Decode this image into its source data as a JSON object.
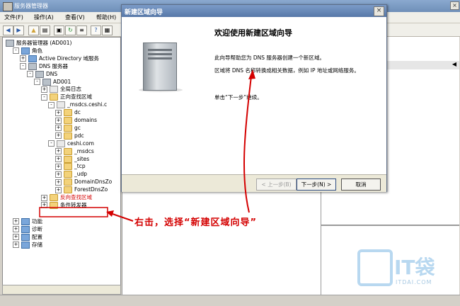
{
  "window": {
    "title": "服务器管理器"
  },
  "menu": [
    "文件(F)",
    "操作(A)",
    "查看(V)",
    "帮助(H)"
  ],
  "tree": [
    {
      "label": "服务器管理器 (AD001)",
      "icon": "server-manager-icon",
      "level": 0,
      "toggle": ""
    },
    {
      "label": "角色",
      "icon": "roles-icon",
      "level": 1,
      "toggle": "-"
    },
    {
      "label": "Active Directory 域服务",
      "icon": "ad-icon",
      "level": 2,
      "toggle": "+"
    },
    {
      "label": "DNS 服务器",
      "icon": "dns-icon",
      "level": 2,
      "toggle": "-"
    },
    {
      "label": "DNS",
      "icon": "dns-icon",
      "level": 3,
      "toggle": "-"
    },
    {
      "label": "AD001",
      "icon": "server-icon",
      "level": 4,
      "toggle": "-"
    },
    {
      "label": "全局日志",
      "icon": "log-icon",
      "level": 5,
      "toggle": "+"
    },
    {
      "label": "正向查找区域",
      "icon": "folder-icon",
      "level": 5,
      "toggle": "-"
    },
    {
      "label": "_msdcs.ceshi.c",
      "icon": "zone-icon",
      "level": 6,
      "toggle": "-"
    },
    {
      "label": "dc",
      "icon": "folder-icon",
      "level": 7,
      "toggle": "+"
    },
    {
      "label": "domains",
      "icon": "folder-icon",
      "level": 7,
      "toggle": "+"
    },
    {
      "label": "gc",
      "icon": "folder-icon",
      "level": 7,
      "toggle": "+"
    },
    {
      "label": "pdc",
      "icon": "folder-icon",
      "level": 7,
      "toggle": "+"
    },
    {
      "label": "ceshi.com",
      "icon": "zone-icon",
      "level": 6,
      "toggle": "-"
    },
    {
      "label": "_msdcs",
      "icon": "folder-icon",
      "level": 7,
      "toggle": "+"
    },
    {
      "label": "_sites",
      "icon": "folder-icon",
      "level": 7,
      "toggle": "+"
    },
    {
      "label": "_tcp",
      "icon": "folder-icon",
      "level": 7,
      "toggle": "+"
    },
    {
      "label": "_udp",
      "icon": "folder-icon",
      "level": 7,
      "toggle": "+"
    },
    {
      "label": "DomainDnsZo",
      "icon": "folder-icon",
      "level": 7,
      "toggle": "+"
    },
    {
      "label": "ForestDnsZo",
      "icon": "folder-icon",
      "level": 7,
      "toggle": "+"
    },
    {
      "label": "反向查找区域",
      "icon": "folder-icon",
      "level": 5,
      "toggle": "+",
      "highlight": true
    },
    {
      "label": "条件转发器",
      "icon": "folder-icon",
      "level": 5,
      "toggle": "+"
    },
    {
      "label": "功能",
      "icon": "features-icon",
      "level": 1,
      "toggle": "+"
    },
    {
      "label": "诊断",
      "icon": "diagnostics-icon",
      "level": 1,
      "toggle": "+"
    },
    {
      "label": "配置",
      "icon": "config-icon",
      "level": 1,
      "toggle": "+"
    },
    {
      "label": "存储",
      "icon": "storage-icon",
      "level": 1,
      "toggle": "+"
    }
  ],
  "dialog": {
    "title": "新建区域向导",
    "heading": "欢迎使用新建区域向导",
    "para1": "此向导帮助您为 DNS 服务器创建一个新区域。",
    "para2": "区域将 DNS 名称转换成相关数据，例如 IP 地址或网络服务。",
    "para3": "单击“下一步”继续。",
    "back_label": "< 上一步(B)",
    "next_label": "下一步(N) >",
    "cancel_label": "取消"
  },
  "annotation": "右击，选择“新建区域向导”",
  "watermark": {
    "brand": "IT袋",
    "url": "ITDAI.COM"
  },
  "colors": {
    "arrow": "#d40000",
    "highlight": "#d40000"
  }
}
